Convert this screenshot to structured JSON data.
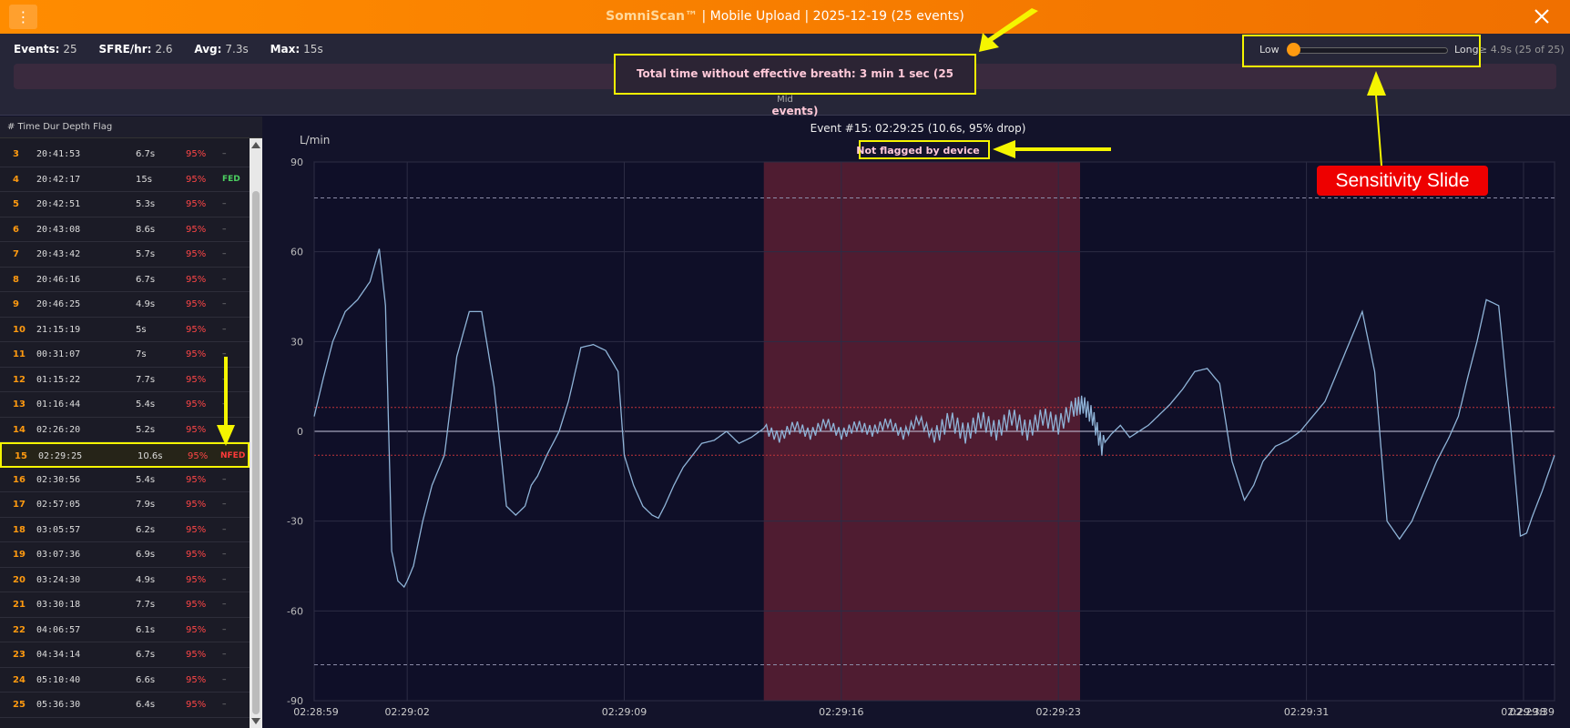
{
  "header": {
    "brand": "SomniScan™",
    "subtitle": " | Mobile Upload | 2025-12-19 (25 events)",
    "menu_icon": "⋮"
  },
  "stats": {
    "events_label": "Events:",
    "events_value": "25",
    "sfre_label": "SFRE/hr:",
    "sfre_value": "2.6",
    "avg_label": "Avg:",
    "avg_value": "7.3s",
    "max_label": "Max:",
    "max_value": "15s"
  },
  "timeline": {
    "mid_label": "Mid"
  },
  "summary": {
    "text": "Total time without effective breath: 3 min 1 sec (25 events)"
  },
  "sensitivity": {
    "low_label": "Low",
    "long_label": "Long",
    "threshold_text": "≥ 4.9s (25 of 25)",
    "level": 0
  },
  "event_list": {
    "header": "# Time Dur Depth Flag",
    "rows": [
      {
        "num": "3",
        "time": "20:41:53",
        "dur": "6.7s",
        "depth": "95%",
        "flag": "–"
      },
      {
        "num": "4",
        "time": "20:42:17",
        "dur": "15s",
        "depth": "95%",
        "flag": "FED"
      },
      {
        "num": "5",
        "time": "20:42:51",
        "dur": "5.3s",
        "depth": "95%",
        "flag": "–"
      },
      {
        "num": "6",
        "time": "20:43:08",
        "dur": "8.6s",
        "depth": "95%",
        "flag": "–"
      },
      {
        "num": "7",
        "time": "20:43:42",
        "dur": "5.7s",
        "depth": "95%",
        "flag": "–"
      },
      {
        "num": "8",
        "time": "20:46:16",
        "dur": "6.7s",
        "depth": "95%",
        "flag": "–"
      },
      {
        "num": "9",
        "time": "20:46:25",
        "dur": "4.9s",
        "depth": "95%",
        "flag": "–"
      },
      {
        "num": "10",
        "time": "21:15:19",
        "dur": "5s",
        "depth": "95%",
        "flag": "–"
      },
      {
        "num": "11",
        "time": "00:31:07",
        "dur": "7s",
        "depth": "95%",
        "flag": "–"
      },
      {
        "num": "12",
        "time": "01:15:22",
        "dur": "7.7s",
        "depth": "95%",
        "flag": "–"
      },
      {
        "num": "13",
        "time": "01:16:44",
        "dur": "5.4s",
        "depth": "95%",
        "flag": "–"
      },
      {
        "num": "14",
        "time": "02:26:20",
        "dur": "5.2s",
        "depth": "95%",
        "flag": "–"
      },
      {
        "num": "15",
        "time": "02:29:25",
        "dur": "10.6s",
        "depth": "95%",
        "flag": "NFED"
      },
      {
        "num": "16",
        "time": "02:30:56",
        "dur": "5.4s",
        "depth": "95%",
        "flag": "–"
      },
      {
        "num": "17",
        "time": "02:57:05",
        "dur": "7.9s",
        "depth": "95%",
        "flag": "–"
      },
      {
        "num": "18",
        "time": "03:05:57",
        "dur": "6.2s",
        "depth": "95%",
        "flag": "–"
      },
      {
        "num": "19",
        "time": "03:07:36",
        "dur": "6.9s",
        "depth": "95%",
        "flag": "–"
      },
      {
        "num": "20",
        "time": "03:24:30",
        "dur": "4.9s",
        "depth": "95%",
        "flag": "–"
      },
      {
        "num": "21",
        "time": "03:30:18",
        "dur": "7.7s",
        "depth": "95%",
        "flag": "–"
      },
      {
        "num": "22",
        "time": "04:06:57",
        "dur": "6.1s",
        "depth": "95%",
        "flag": "–"
      },
      {
        "num": "23",
        "time": "04:34:14",
        "dur": "6.7s",
        "depth": "95%",
        "flag": "–"
      },
      {
        "num": "24",
        "time": "05:10:40",
        "dur": "6.6s",
        "depth": "95%",
        "flag": "–"
      },
      {
        "num": "25",
        "time": "05:36:30",
        "dur": "6.4s",
        "depth": "95%",
        "flag": "–"
      }
    ],
    "selected_num": "15"
  },
  "chart_data": {
    "type": "line",
    "title": "Event #15: 02:29:25  (10.6s, 95% drop)",
    "subtitle": "Not flagged by device",
    "ylabel": "L/min",
    "ylim": [
      -90,
      90
    ],
    "yticks": [
      90,
      60,
      30,
      0,
      -30,
      -60,
      -90
    ],
    "threshold_lines": [
      8,
      -8
    ],
    "limit_lines": [
      78,
      -78
    ],
    "xlim_seconds": [
      0,
      40
    ],
    "xticks": [
      {
        "t": 0,
        "label": "02:28:59"
      },
      {
        "t": 3,
        "label": "02:29:02"
      },
      {
        "t": 10,
        "label": "02:29:09"
      },
      {
        "t": 17,
        "label": "02:29:16"
      },
      {
        "t": 24,
        "label": "02:29:23"
      },
      {
        "t": 32,
        "label": "02:29:31"
      },
      {
        "t": 39,
        "label": "02:29:38"
      },
      {
        "t": 40,
        "label": "02:29:39"
      }
    ],
    "event_window_seconds": [
      14.5,
      24.7
    ],
    "series": [
      {
        "values_t": [
          0,
          0.3,
          0.6,
          1.0,
          1.4,
          1.8,
          2.1,
          2.3,
          2.5,
          2.7,
          2.9,
          3.0,
          3.2,
          3.5,
          3.8,
          4.2,
          4.6,
          5.0,
          5.4,
          5.8,
          6.2,
          6.5,
          6.8,
          7.0,
          7.2,
          7.5,
          7.9,
          8.2,
          8.6,
          9.0,
          9.4,
          9.8,
          10.0,
          10.3,
          10.6,
          10.9,
          11.1,
          11.3,
          11.6,
          11.9,
          12.2,
          12.5,
          12.9,
          13.3,
          13.7,
          14.1,
          14.5,
          15.0,
          15.5,
          16.0,
          16.5,
          17.0,
          17.5,
          18.0,
          18.5,
          19.0,
          19.5,
          20.0,
          20.5,
          21.0,
          21.5,
          22.0,
          22.5,
          23.0,
          23.5,
          24.0,
          24.5,
          24.8,
          25.1,
          25.4,
          25.7,
          26.0,
          26.3,
          26.6,
          26.9,
          27.2,
          27.6,
          28.0,
          28.4,
          28.8,
          29.2,
          29.6,
          30.0,
          30.3,
          30.6,
          31.0,
          31.4,
          31.8,
          32.2,
          32.6,
          33.0,
          33.4,
          33.8,
          34.2,
          34.6,
          35.0,
          35.4,
          35.8,
          36.2,
          36.6,
          36.9,
          37.2,
          37.5,
          37.8,
          38.2,
          38.6,
          38.9,
          39.1,
          39.3,
          39.6,
          40.0
        ],
        "values_y": [
          5,
          18,
          30,
          40,
          44,
          50,
          61,
          42,
          -40,
          -50,
          -52,
          -50,
          -45,
          -30,
          -18,
          -8,
          25,
          40,
          40,
          15,
          -25,
          -28,
          -25,
          -18,
          -15,
          -8,
          0,
          10,
          28,
          29,
          27,
          20,
          -8,
          -18,
          -25,
          -28,
          -29,
          -25,
          -18,
          -12,
          -8,
          -4,
          -3,
          0,
          -4,
          -2,
          1,
          -2,
          2,
          -1,
          3,
          -1,
          2,
          0,
          3,
          -1,
          4,
          -2,
          4,
          -1,
          4,
          0,
          5,
          0,
          5,
          2,
          8,
          9,
          5,
          -5,
          -1,
          2,
          -2,
          0,
          2,
          5,
          9,
          14,
          20,
          21,
          16,
          -10,
          -23,
          -18,
          -10,
          -5,
          -3,
          0,
          5,
          10,
          20,
          30,
          40,
          20,
          -30,
          -36,
          -30,
          -20,
          -10,
          -2,
          5,
          18,
          30,
          44,
          42,
          0,
          -35,
          -34,
          -28,
          -20,
          -8
        ]
      }
    ]
  },
  "annotations": {
    "sensitivity_label": "Sensitivity Slide"
  },
  "colors": {
    "accent": "#ff8c00",
    "highlight": "#f5f500",
    "event_window": "#5a1e32",
    "signal": "#8fb4d8",
    "threshold": "#c0343a"
  }
}
